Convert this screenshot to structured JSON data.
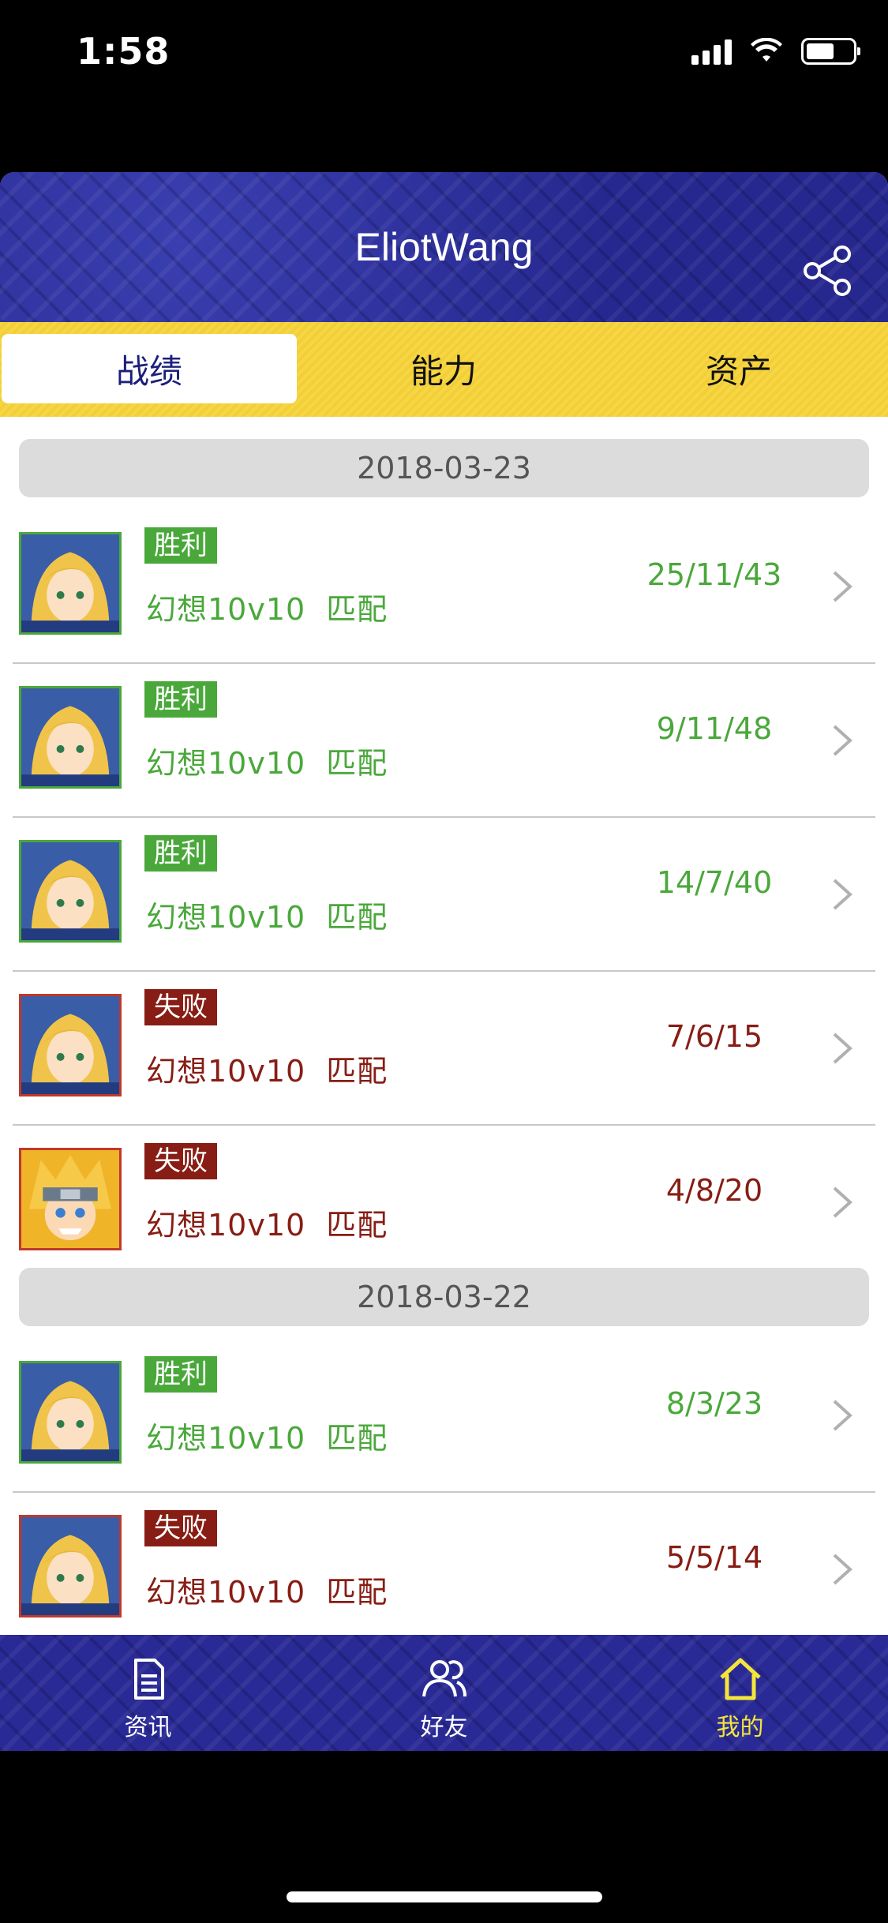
{
  "status_bar": {
    "time": "1:58"
  },
  "header": {
    "title": "EliotWang"
  },
  "tabs": [
    {
      "label": "战绩",
      "active": true
    },
    {
      "label": "能力",
      "active": false
    },
    {
      "label": "资产",
      "active": false
    }
  ],
  "groups": [
    {
      "date": "2018-03-23",
      "matches": [
        {
          "result": "胜利",
          "outcome": "win",
          "mode": "幻想10v10",
          "type": "匹配",
          "kda": "25/11/43",
          "hero": "blonde-knight"
        },
        {
          "result": "胜利",
          "outcome": "win",
          "mode": "幻想10v10",
          "type": "匹配",
          "kda": "9/11/48",
          "hero": "blonde-knight"
        },
        {
          "result": "胜利",
          "outcome": "win",
          "mode": "幻想10v10",
          "type": "匹配",
          "kda": "14/7/40",
          "hero": "blonde-knight"
        },
        {
          "result": "失败",
          "outcome": "lose",
          "mode": "幻想10v10",
          "type": "匹配",
          "kda": "7/6/15",
          "hero": "blonde-knight"
        },
        {
          "result": "失败",
          "outcome": "lose",
          "mode": "幻想10v10",
          "type": "匹配",
          "kda": "4/8/20",
          "hero": "orange-ninja"
        }
      ]
    },
    {
      "date": "2018-03-22",
      "matches": [
        {
          "result": "胜利",
          "outcome": "win",
          "mode": "幻想10v10",
          "type": "匹配",
          "kda": "8/3/23",
          "hero": "blonde-knight"
        },
        {
          "result": "失败",
          "outcome": "lose",
          "mode": "幻想10v10",
          "type": "匹配",
          "kda": "5/5/14",
          "hero": "blonde-knight"
        }
      ]
    }
  ],
  "tabbar": [
    {
      "label": "资讯",
      "icon": "document-icon",
      "active": false
    },
    {
      "label": "好友",
      "icon": "friends-icon",
      "active": false
    },
    {
      "label": "我的",
      "icon": "home-icon",
      "active": true
    }
  ],
  "colors": {
    "win": "#4aa83b",
    "lose": "#871d14",
    "header": "#2a2a96",
    "tab_bg": "#f6d641",
    "active_tab_text": "#1c1f7a"
  }
}
